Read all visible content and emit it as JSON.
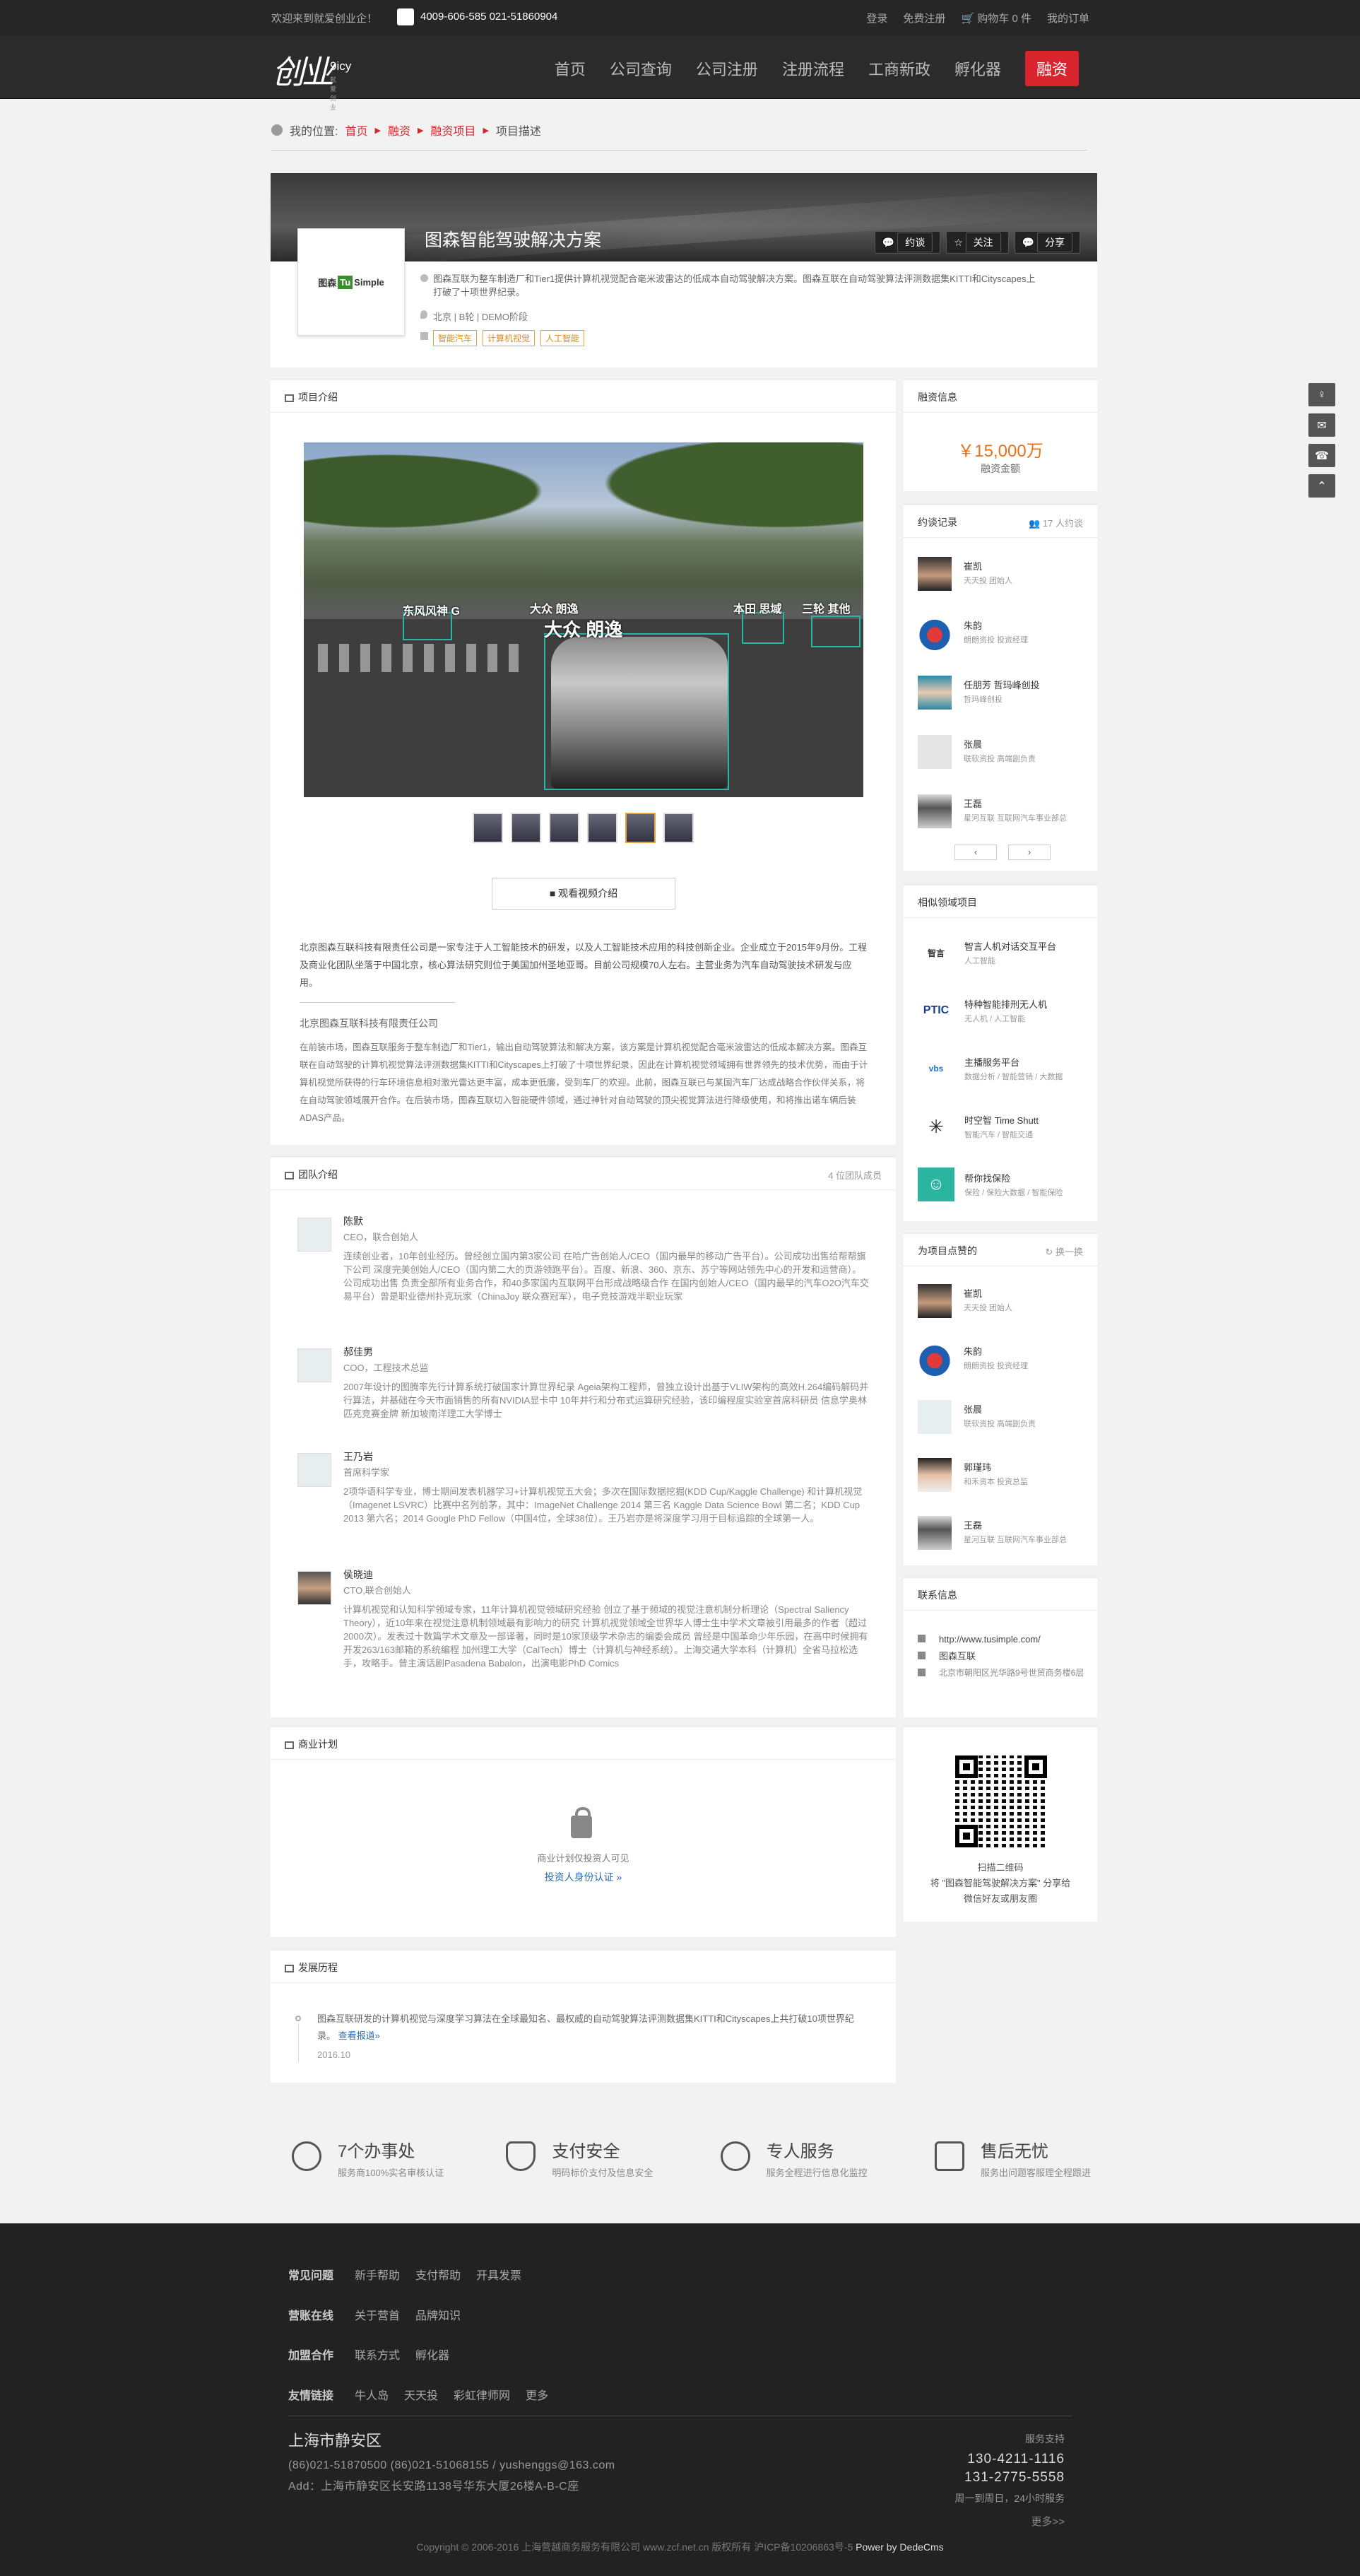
{
  "topbar": {
    "welcome": "欢迎来到就爱创业企！",
    "phone": "4009-606-585 021-51860904",
    "links": [
      "登录",
      "免费注册",
      "购物车 0 件",
      "我的订单"
    ]
  },
  "header": {
    "logo_text": "9icy",
    "logo_sub": "就爱创业",
    "nav": [
      "首页",
      "公司查询",
      "公司注册",
      "注册流程",
      "工商新政",
      "孵化器",
      "融资"
    ]
  },
  "breadcrumb": {
    "label": "我的位置:",
    "items": [
      "首页",
      "融资",
      "融资项目",
      "项目描述"
    ]
  },
  "project": {
    "title": "图森智能驾驶解决方案",
    "actions": [
      "约谈",
      "关注",
      "分享"
    ],
    "logo_text_a": "图森",
    "logo_text_b": "Tu",
    "logo_text_c": "Simple",
    "desc": "图森互联为整车制造厂和Tier1提供计算机视觉配合毫米波雷达的低成本自动驾驶解决方案。图森互联在自动驾驶算法评测数据集KITTI和Cityscapes上打破了十项世界纪录。",
    "location": "北京 | B轮 | DEMO阶段",
    "tags": [
      "智能汽车",
      "计算机视觉",
      "人工智能"
    ]
  },
  "intro": {
    "heading": "项目介绍",
    "photo_labels": [
      "东风风神 G",
      "大众 朗逸",
      "大众 朗逸",
      "本田 思域",
      "三轮 其他"
    ],
    "video_button": "观看视频介绍",
    "paragraph": "北京图森互联科技有限责任公司是一家专注于人工智能技术的研发，以及人工智能技术应用的科技创新企业。企业成立于2015年9月份。工程及商业化团队坐落于中国北京，核心算法研究则位于美国加州圣地亚哥。目前公司规模70人左右。主营业务为汽车自动驾驶技术研发与应用。",
    "subtitle": "北京图森互联科技有限责任公司",
    "paragraph2": "在前装市场，图森互联服务于整车制造厂和Tier1，输出自动驾驶算法和解决方案，该方案是计算机视觉配合毫米波雷达的低成本解决方案。图森互联在自动驾驶的计算机视觉算法评测数据集KITTI和Cityscapes上打破了十项世界纪录，因此在计算机视觉领域拥有世界领先的技术优势，而由于计算机视觉所获得的行车环境信息相对激光雷达更丰富，成本更低廉，受到车厂的欢迎。此前，图森互联已与某国汽车厂达成战略合作伙伴关系，将在自动驾驶领域展开合作。在后装市场，图森互联切入智能硬件领域，通过神针对自动驾驶的顶尖视觉算法进行降级使用，和将推出诺车辆后装ADAS产品。"
  },
  "team": {
    "heading": "团队介绍",
    "count": "4 位团队成员",
    "members": [
      {
        "name": "陈默",
        "role": "CEO，联合创始人",
        "desc": "连续创业者，10年创业经历。曾经创立国内第3家公司 在哈广告创始人/CEO（国内最早的移动广告平台）。公司成功出售给帮帮旗下公司 深度完美创始人/CEO（国内第二大的页游领跑平台）。百度、新浪、360、京东、苏宁等网站领先中心的开发和运营商）。公司成功出售 负责全部所有业务合作，和40多家国内互联网平台形成战略级合作 在国内创始人/CEO（国内最早的汽车O2O汽车交易平台）曾是职业德州扑克玩家（ChinaJoy 联众赛冠军），电子竞技游戏半职业玩家"
      },
      {
        "name": "郝佳男",
        "role": "COO，工程技术总监",
        "desc": "2007年设计的图腾率先行计算系统打破国家计算世界纪录 Ageia架构工程师，曾独立设计出基于VLIW架构的高效H.264编码解码并行算法，并基础在今天市面销售的所有NVIDIA显卡中 10年并行和分布式运算研究经验，该印编程度实验室首席科研员 信息学奥林匹克竞赛金牌 新加坡南洋理工大学博士"
      },
      {
        "name": "王乃岩",
        "role": "首席科学家",
        "desc": "2项华语科学专业，博士期间发表机器学习+计算机视觉五大会；多次在国际数据挖掘(KDD Cup/Kaggle Challenge) 和计算机视觉（Imagenet LSVRC）比赛中名列前茅，其中：ImageNet Challenge 2014 第三名 Kaggle Data Science Bowl 第二名；KDD Cup 2013 第六名；2014 Google PhD Fellow（中国4位，全球38位）。王乃岩亦是将深度学习用于目标追踪的全球第一人。"
      },
      {
        "name": "侯晓迪",
        "role": "CTO,联合创始人",
        "desc": "计算机视觉和认知科学领域专家，11年计算机视觉领域研究经验 创立了基于频域的视觉注意机制分析理论（Spectral Saliency Theory），近10年来在视觉注意机制领域最有影响力的研究 计算机视觉领域全世界华人博士生中学术文章被引用最多的作者（超过2000次）。发表过十数篇学术文章及一部译著，同时是10家顶级学术杂志的编委会成员 曾经是中国革命少年乐园，在高中时候拥有开发263/163邮箱的系统编程 加州理工大学（CalTech）博士（计算机与神经系统）。上海交通大学本科（计算机）全省马拉松选手，攻略手。曾主演话剧Pasadena Babalon，出演电影PhD Comics"
      }
    ]
  },
  "plan": {
    "heading": "商业计划",
    "message": "商业计划仅投资人可见",
    "link": "投资人身份认证 »"
  },
  "timeline": {
    "heading": "发展历程",
    "text": "图森互联研发的计算机视觉与深度学习算法在全球最知名、最权威的自动驾驶算法评测数据集KITTI和Cityscapes上共打破10项世界纪录。",
    "link": "查看报道»",
    "date": "2016.10"
  },
  "funding": {
    "heading": "融资信息",
    "amount": "￥15,000万",
    "label": "融资金额"
  },
  "appointments": {
    "heading": "约谈记录",
    "count": "17 人约谈",
    "people": [
      {
        "name": "崔凯",
        "role": "天天投 团始人"
      },
      {
        "name": "朱韵",
        "role": "朗朗资投 投资经理"
      },
      {
        "name": "任朋芳 哲玛峰创投",
        "role": "哲玛峰创投"
      },
      {
        "name": "张晨",
        "role": "联软资投 高端副负责"
      },
      {
        "name": "王磊",
        "role": "星河互联 互联网汽车事业部总"
      }
    ],
    "pager_prev": "‹",
    "pager_next": "›"
  },
  "similar": {
    "heading": "相似领域项目",
    "items": [
      {
        "name": "智言人机对话交互平台",
        "sub": "人工智能",
        "logo": "智言"
      },
      {
        "name": "特种智能排刑无人机",
        "sub": "无人机 / 人工智能",
        "logo": "PTIC"
      },
      {
        "name": "主播服务平台",
        "sub": "数据分析 / 智能营销 / 大数据",
        "logo": "vbs"
      },
      {
        "name": "时空智 Time Shutt",
        "sub": "智能汽车 / 智能交通",
        "logo": "✳"
      },
      {
        "name": "帮你找保险",
        "sub": "保险 / 保险大数据 / 智能保险",
        "logo": "☺"
      }
    ]
  },
  "likes": {
    "heading": "为项目点赞的",
    "refresh": "换一换",
    "people": [
      {
        "name": "崔凯",
        "role": "天天投 团始人"
      },
      {
        "name": "朱韵",
        "role": "朗朗资投 投资经理"
      },
      {
        "name": "张晨",
        "role": "联软资投 高端副负责"
      },
      {
        "name": "郭瑾玮",
        "role": "和禾资本 投资总监"
      },
      {
        "name": "王磊",
        "role": "星河互联 互联网汽车事业部总"
      }
    ]
  },
  "contact": {
    "heading": "联系信息",
    "website": "http://www.tusimple.com/",
    "company": "图森互联",
    "address": "北京市朝阳区光华路9号世贸商务楼6层"
  },
  "qr": {
    "caption1": "扫描二维码",
    "caption2": "将 \"图森智能驾驶解决方案\" 分享给",
    "caption3": "微信好友或朋友圈"
  },
  "guarantees": [
    {
      "title": "7个办事处",
      "sub": "服务商100%实名审核认证"
    },
    {
      "title": "支付安全",
      "sub": "明码标价支付及信息安全"
    },
    {
      "title": "专人服务",
      "sub": "服务全程进行信息化监控"
    },
    {
      "title": "售后无忧",
      "sub": "服务出问题客服理全程跟进"
    }
  ],
  "footer": {
    "rows": [
      {
        "head": "常见问题",
        "items": [
          "新手帮助",
          "支付帮助",
          "开具发票"
        ]
      },
      {
        "head": "营账在线",
        "items": [
          "关于营首",
          "品牌知识"
        ]
      },
      {
        "head": "加盟合作",
        "items": [
          "联系方式",
          "孵化器"
        ]
      },
      {
        "head": "友情链接",
        "items": [
          "牛人岛",
          "天天投",
          "彩虹律师网",
          "更多"
        ]
      }
    ],
    "city": "上海市静安区",
    "phones": "(86)021-51870500     (86)021-51068155 / yushenggs@163.com",
    "address": "Add：上海市静安区长安路1138号华东大厦26楼A-B-C座",
    "support_label": "服务支持",
    "support_1": "130-4211-1116",
    "support_2": "131-2775-5558",
    "hours": "周一到周日，24小时服务",
    "more": "更多>>",
    "copyright": "Copyright © 2006-2016 上海营越商务服务有限公司 www.zcf.net.cn 版权所有 沪ICP备10206863号-5 ",
    "powered": "Power by DedeCms"
  },
  "floats": [
    "♀",
    "✉",
    "☎",
    "⌃"
  ]
}
